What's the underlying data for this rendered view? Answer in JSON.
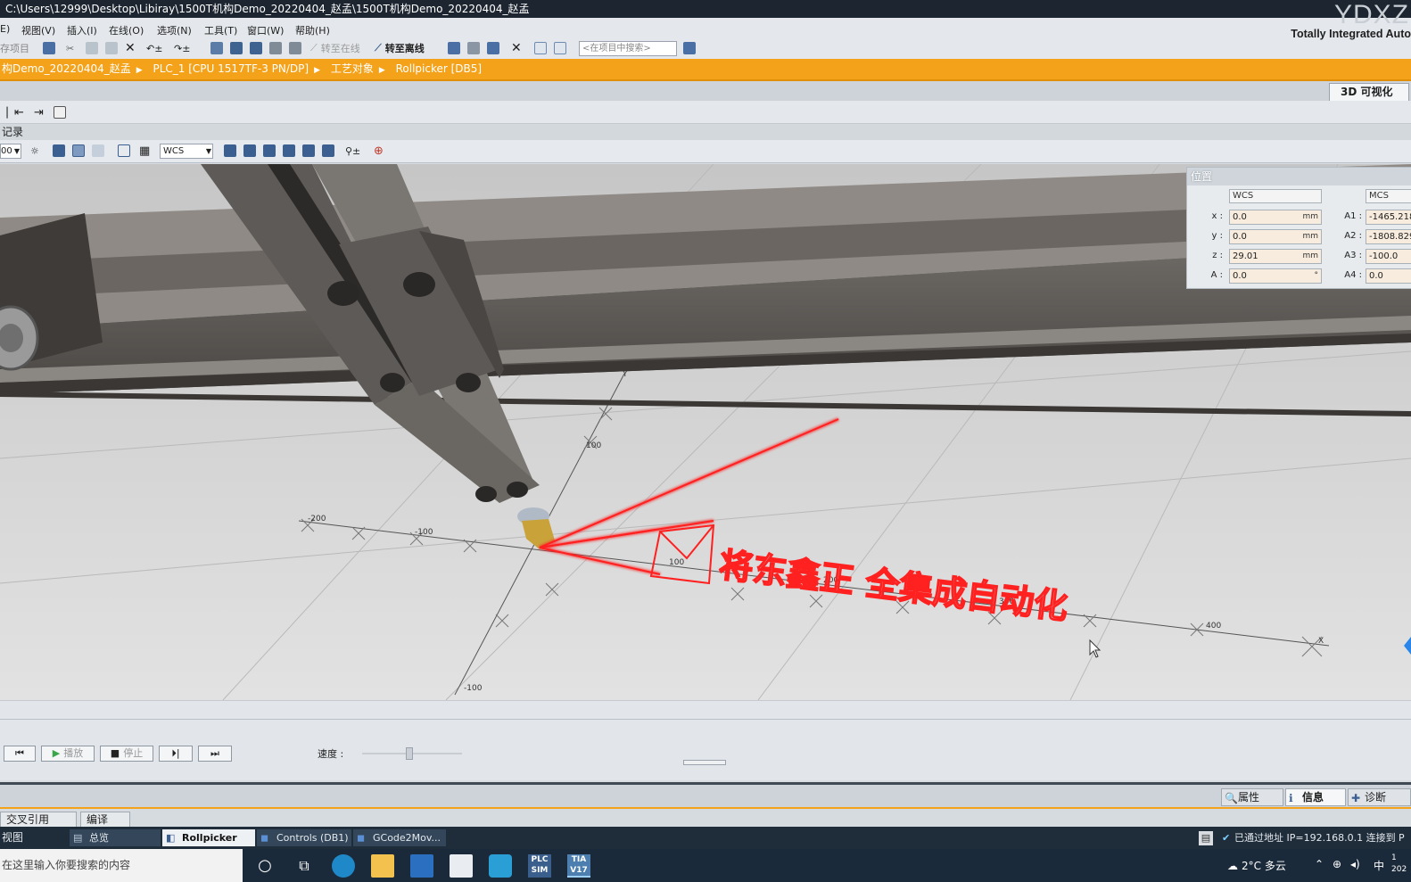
{
  "window": {
    "title": "C:\\Users\\12999\\Desktop\\Libiray\\1500T机构Demo_20220404_赵孟\\1500T机构Demo_20220404_赵孟"
  },
  "menu": {
    "items": [
      "E)",
      "视图(V)",
      "插入(I)",
      "在线(O)",
      "选项(N)",
      "工具(T)",
      "窗口(W)",
      "帮助(H)"
    ]
  },
  "brand": {
    "logo": "YDXZ",
    "subtitle": "Totally Integrated Auto"
  },
  "toolbar": {
    "save_label": "存项目",
    "go_online_label": "转至在线",
    "go_offline_label": "转至离线",
    "search_placeholder": "<在项目中搜索>"
  },
  "breadcrumb": [
    "构Demo_20220404_赵孟",
    "PLC_1 [CPU 1517TF-3 PN/DP]",
    "工艺对象",
    "Rollpicker [DB5]"
  ],
  "editor": {
    "tab_label": "3D 可视化",
    "record_label": "记录",
    "zoom": "00",
    "coord_system": "WCS"
  },
  "position_panel": {
    "title": "位置",
    "left_header": "WCS",
    "right_header": "MCS",
    "left_rows": [
      {
        "label": "x :",
        "value": "0.0",
        "unit": "mm"
      },
      {
        "label": "y :",
        "value": "0.0",
        "unit": "mm"
      },
      {
        "label": "z :",
        "value": "29.01",
        "unit": "mm"
      },
      {
        "label": "A :",
        "value": "0.0",
        "unit": "°"
      }
    ],
    "right_rows": [
      {
        "label": "A1 :",
        "value": "-1465.218"
      },
      {
        "label": "A2 :",
        "value": "-1808.829"
      },
      {
        "label": "A3 :",
        "value": "-100.0"
      },
      {
        "label": "A4 :",
        "value": "0.0"
      }
    ]
  },
  "scene": {
    "axis_labels": [
      "Y",
      "100",
      "-200",
      "-100",
      "100",
      "200",
      "300",
      "400",
      "X",
      "-100"
    ],
    "trace_text": "将东鑫正 全集成自动化"
  },
  "playback": {
    "play_label": "播放",
    "stop_label": "停止",
    "speed_label": "速度 :",
    "speed_level": 0.47
  },
  "inspector_tabs": [
    "属性",
    "信息",
    "诊断"
  ],
  "bottom_tabs": [
    "交叉引用",
    "编译"
  ],
  "portal": {
    "view_label": "视图",
    "tabs": [
      "总览",
      "Rollpicker",
      "Controls (DB1)",
      "GCode2Mov..."
    ],
    "status": "已通过地址 IP=192.168.0.1 连接到 P"
  },
  "taskbar": {
    "search_placeholder": "在这里输入你要搜索的内容",
    "weather": "2°C 多云",
    "ime": "中",
    "clock": "1\n202"
  },
  "colors": {
    "orange": "#f4a21a",
    "trace": "#ff2020",
    "titlebar": "#1c2530",
    "taskbar": "#1b2a3a"
  }
}
